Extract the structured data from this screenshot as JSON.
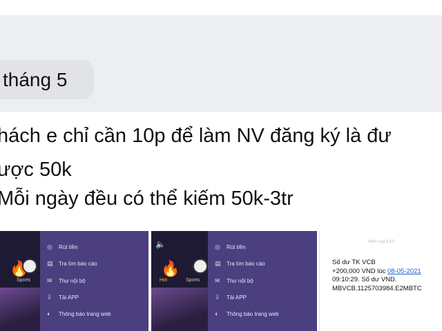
{
  "date_chip": "tháng 5",
  "message_lines": [
    "hách e chỉ cần 10p để làm NV đăng ký là đư",
    "ược 50k",
    "Mỗi ngày đều có thể kiếm 50k-3tr"
  ],
  "app_menu": {
    "items": [
      {
        "label": "Rút tiền",
        "icon": "withdraw-icon"
      },
      {
        "label": "Tra tìm báo cáo",
        "icon": "report-icon"
      },
      {
        "label": "Thư nội bộ",
        "icon": "mail-icon"
      },
      {
        "label": "Tải APP",
        "icon": "download-icon"
      },
      {
        "label": "Thông báo trang web",
        "icon": "notice-icon"
      }
    ],
    "sports_label": "Sports",
    "home_label": "Hot"
  },
  "sms": {
    "header": "Hôm nay 9:10",
    "lines": [
      "Số dư TK VCB",
      "+200,000 VND lúc",
      "09:10:29. Số dư",
      "MBVCB.1125703984.E2MBTC"
    ],
    "date_link": "08-05-2021",
    "vnd_suffix": "VND."
  }
}
